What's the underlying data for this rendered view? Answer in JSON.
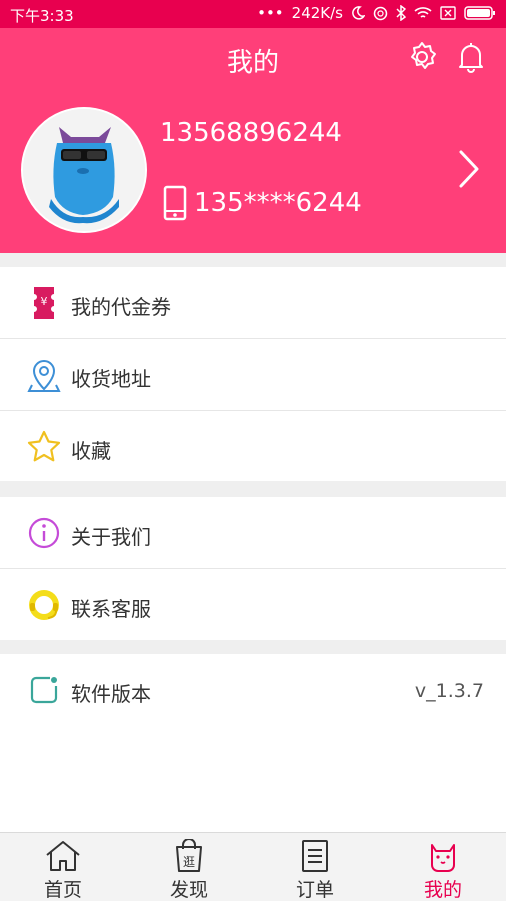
{
  "status_bar": {
    "time": "下午3:33",
    "dots": "•••",
    "speed": "242K/s"
  },
  "header": {
    "title": "我的",
    "phone": "13568896244",
    "phone_masked": "135****6244"
  },
  "menu_groups": [
    [
      {
        "label": "我的代金券",
        "icon": "voucher-icon"
      },
      {
        "label": "收货地址",
        "icon": "location-icon"
      },
      {
        "label": "收藏",
        "icon": "star-icon"
      }
    ],
    [
      {
        "label": "关于我们",
        "icon": "info-icon"
      },
      {
        "label": "联系客服",
        "icon": "headset-icon"
      }
    ],
    [
      {
        "label": "软件版本",
        "value": "v_1.3.7",
        "icon": "version-icon"
      }
    ]
  ],
  "tabs": [
    {
      "label": "首页",
      "icon": "home-icon"
    },
    {
      "label": "发现",
      "icon": "bag-icon",
      "icon_text": "逛"
    },
    {
      "label": "订单",
      "icon": "order-icon"
    },
    {
      "label": "我的",
      "icon": "cat-icon",
      "active": true
    }
  ],
  "colors": {
    "status": "#e8004f",
    "header": "#ff3f79",
    "active_tab": "#e8004f"
  }
}
